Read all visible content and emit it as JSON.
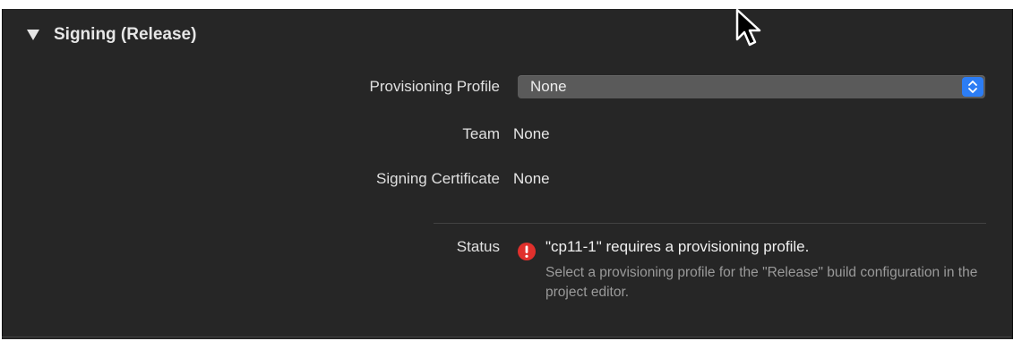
{
  "section": {
    "title": "Signing (Release)"
  },
  "provisioning_profile": {
    "label": "Provisioning Profile",
    "value": "None"
  },
  "team": {
    "label": "Team",
    "value": "None"
  },
  "signing_certificate": {
    "label": "Signing Certificate",
    "value": "None"
  },
  "status": {
    "label": "Status",
    "title": "\"cp11-1\" requires a provisioning profile.",
    "detail": "Select a provisioning profile for the \"Release\" build configuration in the project editor.",
    "icon": "error-icon"
  },
  "colors": {
    "background": "#262626",
    "accent": "#2c7df5",
    "error": "#e0302c"
  }
}
